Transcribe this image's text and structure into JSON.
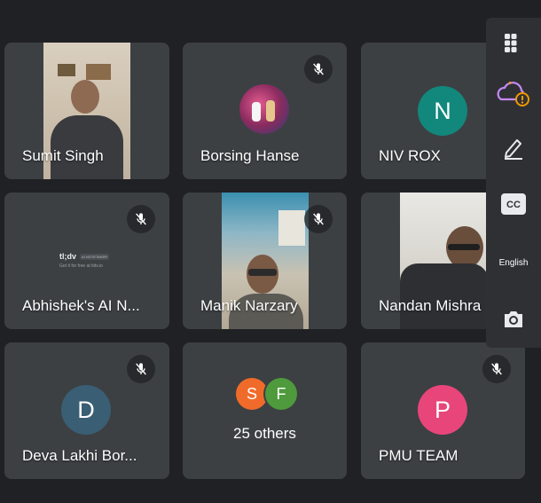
{
  "participants": [
    {
      "name": "Sumit Singh"
    },
    {
      "name": "Borsing Hanse"
    },
    {
      "name": "NIV ROX",
      "initial": "N"
    },
    {
      "name": "Abhishek's AI N...",
      "logo": "tl;dv",
      "logo_badge": "AI NOTETAKER",
      "logo_sub": "Get it for free at tldv.io"
    },
    {
      "name": "Manik Narzary"
    },
    {
      "name": "Nandan Mishra"
    },
    {
      "name": "Deva Lakhi Bor...",
      "initial": "D"
    },
    {
      "name": "PMU TEAM",
      "initial": "P"
    }
  ],
  "others": {
    "label": "25 others",
    "chips": [
      "S",
      "F"
    ]
  },
  "side_panel": {
    "language": "English",
    "cc": "CC"
  },
  "colors": {
    "background": "#202124",
    "tile": "#3c4043",
    "niv_avatar": "#12877b",
    "deva_avatar": "#3a5e73",
    "pmu_avatar": "#e8457b",
    "chip_s": "#f06b2a",
    "chip_f": "#4e9a3c",
    "alert": "#f29900",
    "cloud": "#c58af9"
  }
}
